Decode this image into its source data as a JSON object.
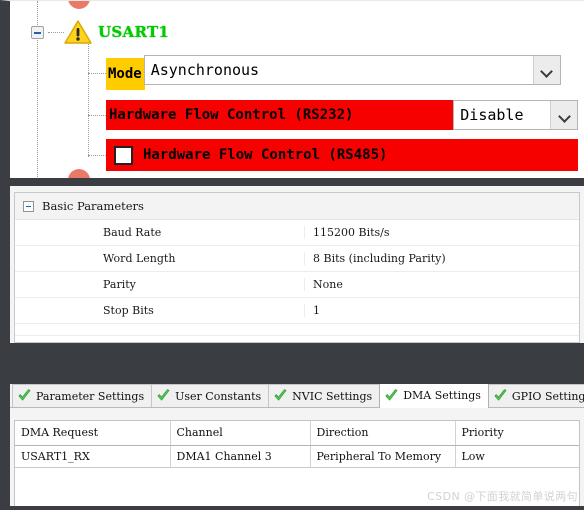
{
  "colors": {
    "node_green": "#00cc00",
    "highlight_yellow": "#ffcc00",
    "error_red": "#f60000",
    "app_chrome_dark": "#3a3d42"
  },
  "tree": {
    "expand_toggle": "collapse-toggle",
    "warning_icon": "warning-triangle-icon",
    "node_label": "USART1",
    "rows": [
      {
        "label": "Mode",
        "label_style": "highlight",
        "control": "combobox",
        "value": "Asynchronous",
        "dropdown_icon": "chevron-down-icon"
      },
      {
        "label": "Hardware Flow Control (RS232)",
        "label_style": "error",
        "control": "combobox",
        "value": "Disable",
        "dropdown_icon": "chevron-down-icon"
      },
      {
        "label": "Hardware Flow Control (RS485)",
        "label_style": "error",
        "control": "checkbox",
        "checked": false
      }
    ]
  },
  "parameters": {
    "group_title": "Basic Parameters",
    "group_toggle": "collapse-toggle",
    "rows": [
      {
        "name": "Baud Rate",
        "value": "115200 Bits/s"
      },
      {
        "name": "Word Length",
        "value": "8 Bits (including Parity)"
      },
      {
        "name": "Parity",
        "value": "None"
      },
      {
        "name": "Stop Bits",
        "value": "1"
      }
    ]
  },
  "tabs": {
    "items": [
      {
        "label": "Parameter Settings",
        "icon": "green-check-icon",
        "active": false
      },
      {
        "label": "User Constants",
        "icon": "green-check-icon",
        "active": false
      },
      {
        "label": "NVIC Settings",
        "icon": "green-check-icon",
        "active": false
      },
      {
        "label": "DMA Settings",
        "icon": "green-check-icon",
        "active": true
      },
      {
        "label": "GPIO Settings",
        "icon": "green-check-icon",
        "active": false
      }
    ]
  },
  "dma_table": {
    "headers": [
      "DMA Request",
      "Channel",
      "Direction",
      "Priority"
    ],
    "rows": [
      [
        "USART1_RX",
        "DMA1 Channel 3",
        "Peripheral To Memory",
        "Low"
      ]
    ]
  },
  "watermark": "CSDN @下面我就简单说两句"
}
